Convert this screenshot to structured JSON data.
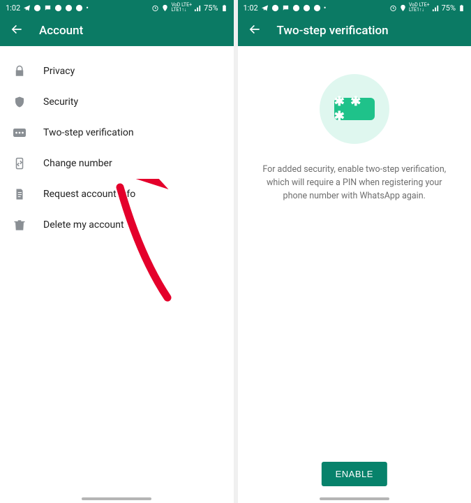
{
  "status": {
    "time": "1:02",
    "battery_pct": "75%"
  },
  "left": {
    "title": "Account",
    "menu": [
      {
        "label": "Privacy",
        "icon": "lock-icon"
      },
      {
        "label": "Security",
        "icon": "shield-icon"
      },
      {
        "label": "Two-step verification",
        "icon": "pin-icon"
      },
      {
        "label": "Change number",
        "icon": "phone-swap-icon"
      },
      {
        "label": "Request account info",
        "icon": "document-icon"
      },
      {
        "label": "Delete my account",
        "icon": "trash-icon"
      }
    ]
  },
  "right": {
    "title": "Two-step verification",
    "badge_stars": "✱ ✱ ✱",
    "description": "For added security, enable two-step verification, which will require a PIN when registering your phone number with WhatsApp again.",
    "enable_label": "ENABLE"
  }
}
